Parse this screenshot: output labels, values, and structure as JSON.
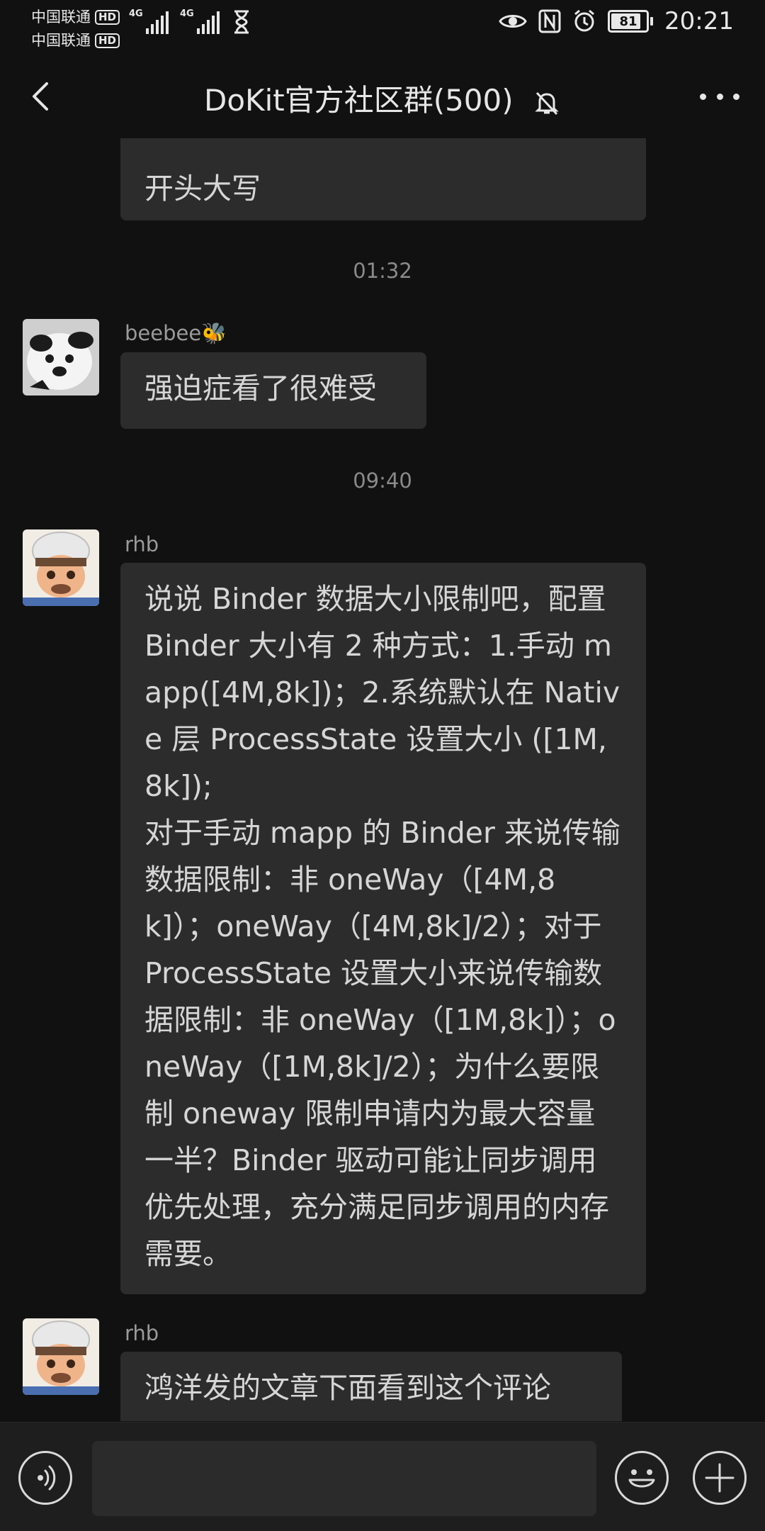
{
  "status_bar": {
    "carrier_1": "中国联通",
    "carrier_2": "中国联通",
    "hd_badge": "HD",
    "network_1": "4G",
    "network_2": "4G",
    "battery_level": "81",
    "time": "20:21"
  },
  "header": {
    "title": "DoKit官方社区群(500)",
    "icons": [
      "back-icon",
      "mute-bell-icon",
      "more-icon"
    ]
  },
  "messages": {
    "partial_top": {
      "text": "开头大写"
    },
    "time_1": "01:32",
    "msg_beebee": {
      "sender": "beebee🐝",
      "text": "强迫症看了很难受"
    },
    "time_2": "09:40",
    "msg_rhb_1": {
      "sender": "rhb",
      "text": "说说 Binder 数据大小限制吧，配置 Binder 大小有 2 种方式：1.手动 mapp([4M,8k])；2.系统默认在 Native 层 ProcessState 设置大小 ([1M,8k]);\n对于手动 mapp 的 Binder 来说传输数据限制：非 oneWay（[4M,8k]）；oneWay（[4M,8k]/2）；对于 ProcessState 设置大小来说传输数据限制：非 oneWay（[1M,8k]）；oneWay（[1M,8k]/2）；为什么要限制 oneway 限制申请内为最大容量一半？Binder 驱动可能让同步调用优先处理，充分满足同步调用的内存需要。"
    },
    "msg_rhb_2": {
      "sender": "rhb",
      "text": "鸿洋发的文章下面看到这个评论"
    }
  },
  "input_bar": {
    "placeholder": "",
    "icons": [
      "voice-icon",
      "emoji-icon",
      "plus-icon"
    ]
  },
  "colors": {
    "background": "#111111",
    "bubble": "#2c2c2c",
    "text": "#d6d6d6"
  }
}
